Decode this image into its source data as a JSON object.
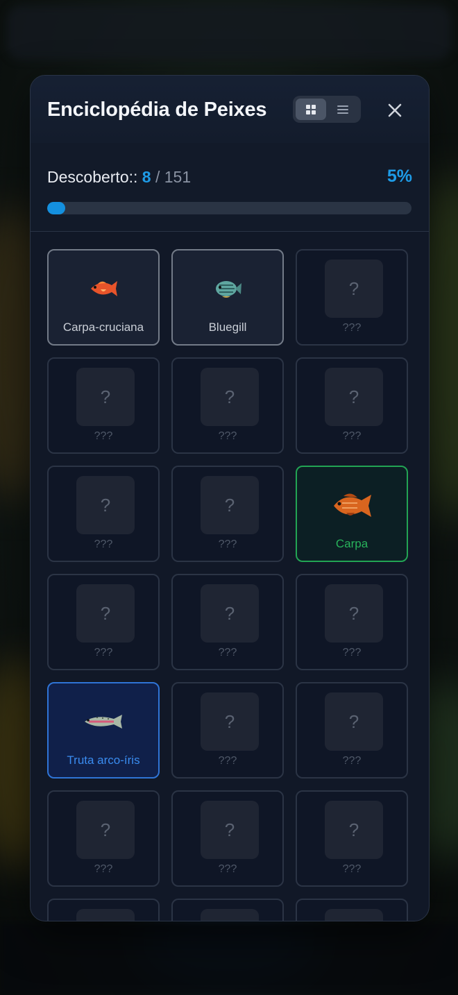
{
  "header": {
    "title": "Enciclopédia de Peixes"
  },
  "progress": {
    "label": "Descoberto::",
    "discovered": "8",
    "separator": "/",
    "total": "151",
    "percent": "5%",
    "fraction": 0.05
  },
  "fish_cards": [
    {
      "label": "Carpa-cruciana",
      "state": "known",
      "icon": "crucian-carp-icon"
    },
    {
      "label": "Bluegill",
      "state": "known",
      "icon": "bluegill-icon"
    },
    {
      "label": "???",
      "state": "unknown",
      "placeholder": "?"
    },
    {
      "label": "???",
      "state": "unknown",
      "placeholder": "?"
    },
    {
      "label": "???",
      "state": "unknown",
      "placeholder": "?"
    },
    {
      "label": "???",
      "state": "unknown",
      "placeholder": "?"
    },
    {
      "label": "???",
      "state": "unknown",
      "placeholder": "?"
    },
    {
      "label": "???",
      "state": "unknown",
      "placeholder": "?"
    },
    {
      "label": "Carpa",
      "state": "green",
      "icon": "carp-icon"
    },
    {
      "label": "???",
      "state": "unknown",
      "placeholder": "?"
    },
    {
      "label": "???",
      "state": "unknown",
      "placeholder": "?"
    },
    {
      "label": "???",
      "state": "unknown",
      "placeholder": "?"
    },
    {
      "label": "Truta arco-íris",
      "state": "blue",
      "icon": "rainbow-trout-icon"
    },
    {
      "label": "???",
      "state": "unknown",
      "placeholder": "?"
    },
    {
      "label": "???",
      "state": "unknown",
      "placeholder": "?"
    },
    {
      "label": "???",
      "state": "unknown",
      "placeholder": "?"
    },
    {
      "label": "???",
      "state": "unknown",
      "placeholder": "?"
    },
    {
      "label": "???",
      "state": "unknown",
      "placeholder": "?"
    }
  ],
  "colors": {
    "accent": "#1e9be6",
    "green_rarity": "#22a454",
    "blue_rarity": "#2f74d6"
  }
}
